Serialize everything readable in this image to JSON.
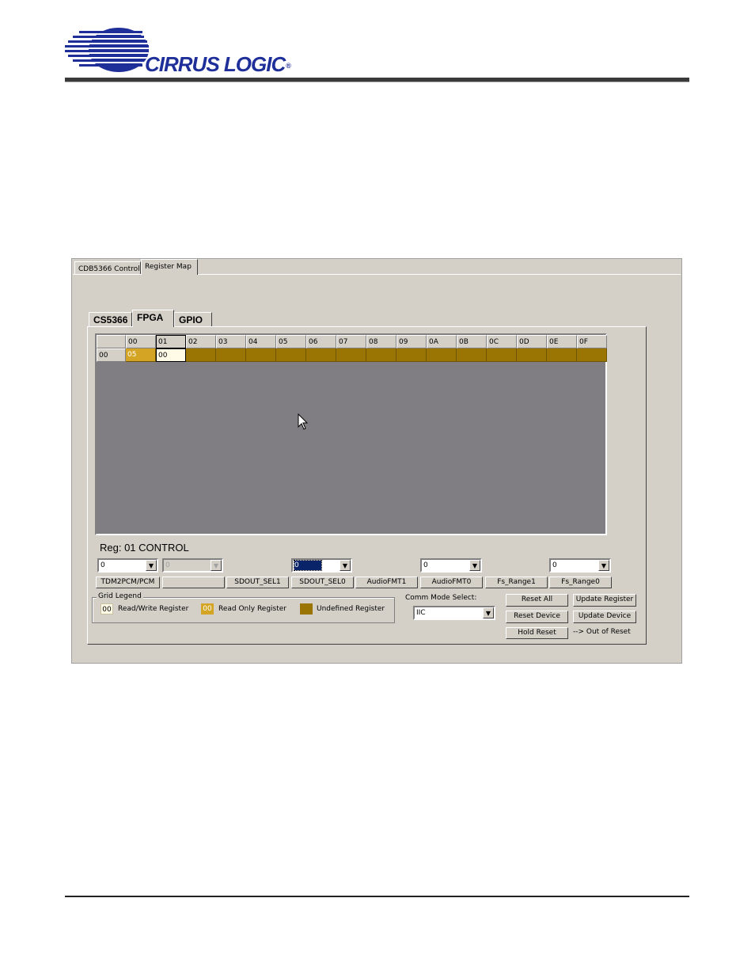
{
  "header": {
    "company": "CIRRUS LOGIC",
    "registered": "®"
  },
  "app": {
    "outer_tabs": [
      "CDB5366 Control",
      "Register Map"
    ],
    "active_outer_tab": "Register Map",
    "inner_tabs": [
      "CS5366",
      "FPGA",
      "GPIO"
    ],
    "active_inner_tab": "FPGA",
    "grid": {
      "columns": [
        "00",
        "01",
        "02",
        "03",
        "04",
        "05",
        "06",
        "07",
        "08",
        "09",
        "0A",
        "0B",
        "0C",
        "0D",
        "0E",
        "0F"
      ],
      "rows": [
        {
          "label": "00",
          "cells": [
            "05",
            "00",
            "",
            "",
            "",
            "",
            "",
            "",
            "",
            "",
            "",
            "",
            "",
            "",
            "",
            ""
          ]
        }
      ],
      "selected_column": "01"
    },
    "register_title": "Reg: 01 CONTROL",
    "combos": [
      {
        "value": "0"
      },
      {
        "value": "0"
      },
      {
        "value": "0"
      },
      {
        "value": "0"
      },
      {
        "value": "0"
      }
    ],
    "bit_buttons": [
      "TDM2PCM/PCM",
      "",
      "SDOUT_SEL1",
      "SDOUT_SEL0",
      "AudioFMT1",
      "AudioFMT0",
      "Fs_Range1",
      "Fs_Range0"
    ],
    "legend": {
      "title": "Grid Legend",
      "items": [
        {
          "swatch": "00",
          "label": "Read/Write Register",
          "color": "#fffbe6"
        },
        {
          "swatch": "00",
          "label": "Read Only Register",
          "color": "#d4a524"
        },
        {
          "swatch": "",
          "label": "Undefined Register",
          "color": "#9a7504"
        }
      ]
    },
    "comm_mode": {
      "label": "Comm Mode Select:",
      "value": "IIC"
    },
    "buttons": {
      "reset_all": "Reset All",
      "update_register": "Update Register",
      "reset_device": "Reset Device",
      "update_device": "Update Device",
      "hold_reset": "Hold Reset"
    },
    "status_text": "--> Out of Reset"
  }
}
